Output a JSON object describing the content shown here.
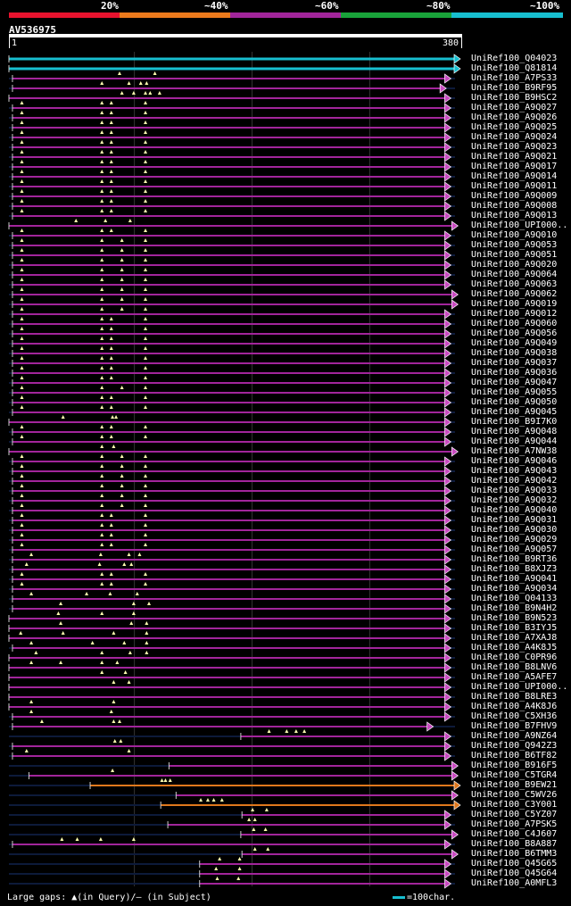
{
  "legend": [
    {
      "label": "20%",
      "color": "#e8132e"
    },
    {
      "label": "~40%",
      "color": "#ec7a1c"
    },
    {
      "label": "~60%",
      "color": "#a2259b"
    },
    {
      "label": "~80%",
      "color": "#19a33a"
    },
    {
      "label": "~100%",
      "color": "#17becf"
    }
  ],
  "query": {
    "name": "AV536975",
    "start": "1",
    "end": "380"
  },
  "footer": {
    "gaps": "Large gaps: ▲(in Query)/— (in Subject)",
    "scale": "=100char."
  },
  "hits": [
    {
      "name": "UniRef100_Q04023",
      "start": 1,
      "end": 380,
      "color": "cyan",
      "arrow": true,
      "marks": []
    },
    {
      "name": "UniRef100_Q81814",
      "start": 1,
      "end": 380,
      "color": "cyan",
      "arrow": true,
      "marks": []
    },
    {
      "name": "UniRef100_A7PS33",
      "start": 4,
      "end": 372,
      "color": "mag",
      "arrow": true,
      "marks": [
        95,
        125
      ]
    },
    {
      "name": "UniRef100_B9RF95",
      "start": 4,
      "end": 368,
      "color": "mag",
      "arrow": true,
      "marks": [
        80,
        103,
        113,
        118
      ]
    },
    {
      "name": "UniRef100_B9HSC2",
      "start": 1,
      "end": 372,
      "color": "mag",
      "arrow": true,
      "marks": [
        97,
        107,
        117,
        121,
        129
      ]
    },
    {
      "name": "UniRef100_A9Q027",
      "start": 4,
      "end": 372,
      "color": "mag",
      "arrow": true,
      "marks": [
        12,
        80,
        88,
        117
      ]
    },
    {
      "name": "UniRef100_A9Q026",
      "start": 4,
      "end": 372,
      "color": "mag",
      "arrow": true,
      "marks": [
        12,
        80,
        88,
        117
      ]
    },
    {
      "name": "UniRef100_A9Q025",
      "start": 4,
      "end": 372,
      "color": "mag",
      "arrow": true,
      "marks": [
        12,
        80,
        88,
        117
      ]
    },
    {
      "name": "UniRef100_A9Q024",
      "start": 4,
      "end": 372,
      "color": "mag",
      "arrow": true,
      "marks": [
        12,
        80,
        88,
        117
      ]
    },
    {
      "name": "UniRef100_A9Q023",
      "start": 4,
      "end": 372,
      "color": "mag",
      "arrow": true,
      "marks": [
        12,
        80,
        88,
        117
      ]
    },
    {
      "name": "UniRef100_A9Q021",
      "start": 4,
      "end": 372,
      "color": "mag",
      "arrow": true,
      "marks": [
        12,
        80,
        88,
        117
      ]
    },
    {
      "name": "UniRef100_A9Q017",
      "start": 4,
      "end": 372,
      "color": "mag",
      "arrow": true,
      "marks": [
        12,
        80,
        88,
        117
      ]
    },
    {
      "name": "UniRef100_A9Q014",
      "start": 4,
      "end": 372,
      "color": "mag",
      "arrow": true,
      "marks": [
        12,
        80,
        88,
        117
      ]
    },
    {
      "name": "UniRef100_A9Q011",
      "start": 4,
      "end": 372,
      "color": "mag",
      "arrow": true,
      "marks": [
        12,
        80,
        88,
        117
      ]
    },
    {
      "name": "UniRef100_A9Q009",
      "start": 4,
      "end": 372,
      "color": "mag",
      "arrow": true,
      "marks": [
        12,
        80,
        88,
        117
      ]
    },
    {
      "name": "UniRef100_A9Q008",
      "start": 4,
      "end": 372,
      "color": "mag",
      "arrow": true,
      "marks": [
        12,
        80,
        88,
        117
      ]
    },
    {
      "name": "UniRef100_A9Q013",
      "start": 4,
      "end": 372,
      "color": "mag",
      "arrow": true,
      "marks": [
        12,
        80,
        88,
        117
      ]
    },
    {
      "name": "UniRef100_UPI000..",
      "start": 1,
      "end": 378,
      "color": "mag",
      "arrow": true,
      "marks": [
        58,
        83,
        104
      ]
    },
    {
      "name": "UniRef100_A9Q010",
      "start": 4,
      "end": 372,
      "color": "mag",
      "arrow": true,
      "marks": [
        12,
        80,
        88,
        117
      ]
    },
    {
      "name": "UniRef100_A9Q053",
      "start": 4,
      "end": 372,
      "color": "mag",
      "arrow": true,
      "marks": [
        12,
        80,
        97,
        117
      ]
    },
    {
      "name": "UniRef100_A9Q051",
      "start": 4,
      "end": 372,
      "color": "mag",
      "arrow": true,
      "marks": [
        12,
        80,
        97,
        117
      ]
    },
    {
      "name": "UniRef100_A9Q020",
      "start": 4,
      "end": 372,
      "color": "mag",
      "arrow": true,
      "marks": [
        12,
        80,
        97,
        117
      ]
    },
    {
      "name": "UniRef100_A9Q064",
      "start": 4,
      "end": 372,
      "color": "mag",
      "arrow": true,
      "marks": [
        12,
        80,
        97,
        117
      ]
    },
    {
      "name": "UniRef100_A9Q063",
      "start": 4,
      "end": 372,
      "color": "mag",
      "arrow": true,
      "marks": [
        12,
        80,
        97,
        117
      ]
    },
    {
      "name": "UniRef100_A9Q062",
      "start": 4,
      "end": 378,
      "color": "mag",
      "arrow": true,
      "marks": [
        12,
        80,
        97,
        117
      ]
    },
    {
      "name": "UniRef100_A9Q019",
      "start": 4,
      "end": 378,
      "color": "mag",
      "arrow": true,
      "marks": [
        12,
        80,
        97,
        117
      ]
    },
    {
      "name": "UniRef100_A9Q012",
      "start": 4,
      "end": 372,
      "color": "mag",
      "arrow": true,
      "marks": [
        12,
        80,
        97,
        117
      ]
    },
    {
      "name": "UniRef100_A9Q060",
      "start": 4,
      "end": 372,
      "color": "mag",
      "arrow": true,
      "marks": [
        12,
        80,
        88,
        117
      ]
    },
    {
      "name": "UniRef100_A9Q056",
      "start": 4,
      "end": 372,
      "color": "mag",
      "arrow": true,
      "marks": [
        12,
        80,
        88,
        117
      ]
    },
    {
      "name": "UniRef100_A9Q049",
      "start": 4,
      "end": 372,
      "color": "mag",
      "arrow": true,
      "marks": [
        12,
        80,
        88,
        117
      ]
    },
    {
      "name": "UniRef100_A9Q038",
      "start": 4,
      "end": 372,
      "color": "mag",
      "arrow": true,
      "marks": [
        12,
        80,
        88,
        117
      ]
    },
    {
      "name": "UniRef100_A9Q037",
      "start": 4,
      "end": 372,
      "color": "mag",
      "arrow": true,
      "marks": [
        12,
        80,
        88,
        117
      ]
    },
    {
      "name": "UniRef100_A9Q036",
      "start": 4,
      "end": 372,
      "color": "mag",
      "arrow": true,
      "marks": [
        12,
        80,
        88,
        117
      ]
    },
    {
      "name": "UniRef100_A9Q047",
      "start": 4,
      "end": 372,
      "color": "mag",
      "arrow": true,
      "marks": [
        12,
        80,
        88,
        117
      ]
    },
    {
      "name": "UniRef100_A9Q055",
      "start": 4,
      "end": 372,
      "color": "mag",
      "arrow": true,
      "marks": [
        12,
        80,
        97,
        117
      ]
    },
    {
      "name": "UniRef100_A9Q050",
      "start": 4,
      "end": 372,
      "color": "mag",
      "arrow": true,
      "marks": [
        12,
        80,
        88,
        117
      ]
    },
    {
      "name": "UniRef100_A9Q045",
      "start": 4,
      "end": 372,
      "color": "mag",
      "arrow": true,
      "marks": [
        12,
        80,
        88,
        117
      ]
    },
    {
      "name": "UniRef100_B9I7K0",
      "start": 1,
      "end": 372,
      "color": "mag",
      "arrow": true,
      "marks": [
        47,
        89,
        92
      ]
    },
    {
      "name": "UniRef100_A9Q048",
      "start": 4,
      "end": 372,
      "color": "mag",
      "arrow": true,
      "marks": [
        12,
        80,
        88,
        117
      ]
    },
    {
      "name": "UniRef100_A9Q044",
      "start": 4,
      "end": 372,
      "color": "mag",
      "arrow": true,
      "marks": [
        12,
        80,
        88,
        117
      ]
    },
    {
      "name": "UniRef100_A7NW38",
      "start": 1,
      "end": 378,
      "color": "mag",
      "arrow": true,
      "marks": [
        80,
        90
      ]
    },
    {
      "name": "UniRef100_A9Q046",
      "start": 4,
      "end": 372,
      "color": "mag",
      "arrow": true,
      "marks": [
        12,
        80,
        97,
        117
      ]
    },
    {
      "name": "UniRef100_A9Q043",
      "start": 4,
      "end": 372,
      "color": "mag",
      "arrow": true,
      "marks": [
        12,
        80,
        97,
        117
      ]
    },
    {
      "name": "UniRef100_A9Q042",
      "start": 4,
      "end": 372,
      "color": "mag",
      "arrow": true,
      "marks": [
        12,
        80,
        97,
        117
      ]
    },
    {
      "name": "UniRef100_A9Q033",
      "start": 4,
      "end": 372,
      "color": "mag",
      "arrow": true,
      "marks": [
        12,
        80,
        97,
        117
      ]
    },
    {
      "name": "UniRef100_A9Q032",
      "start": 4,
      "end": 372,
      "color": "mag",
      "arrow": true,
      "marks": [
        12,
        80,
        97,
        117
      ]
    },
    {
      "name": "UniRef100_A9Q040",
      "start": 4,
      "end": 372,
      "color": "mag",
      "arrow": true,
      "marks": [
        12,
        80,
        97,
        117
      ]
    },
    {
      "name": "UniRef100_A9Q031",
      "start": 4,
      "end": 372,
      "color": "mag",
      "arrow": true,
      "marks": [
        12,
        80,
        88,
        117
      ]
    },
    {
      "name": "UniRef100_A9Q030",
      "start": 4,
      "end": 372,
      "color": "mag",
      "arrow": true,
      "marks": [
        12,
        80,
        88,
        117
      ]
    },
    {
      "name": "UniRef100_A9Q029",
      "start": 4,
      "end": 372,
      "color": "mag",
      "arrow": true,
      "marks": [
        12,
        80,
        88,
        117
      ]
    },
    {
      "name": "UniRef100_A9Q057",
      "start": 4,
      "end": 372,
      "color": "mag",
      "arrow": true,
      "marks": [
        12,
        80,
        88,
        117
      ]
    },
    {
      "name": "UniRef100_B9RT36",
      "start": 4,
      "end": 372,
      "color": "mag",
      "arrow": true,
      "marks": [
        20,
        79,
        103,
        112
      ]
    },
    {
      "name": "UniRef100_B8XJZ3",
      "start": 4,
      "end": 372,
      "color": "mag",
      "arrow": true,
      "marks": [
        16,
        78,
        99,
        105
      ]
    },
    {
      "name": "UniRef100_A9Q041",
      "start": 4,
      "end": 372,
      "color": "mag",
      "arrow": true,
      "marks": [
        12,
        80,
        88,
        117
      ]
    },
    {
      "name": "UniRef100_A9Q034",
      "start": 4,
      "end": 372,
      "color": "mag",
      "arrow": true,
      "marks": [
        12,
        80,
        88,
        117
      ]
    },
    {
      "name": "UniRef100_Q04133",
      "start": 4,
      "end": 372,
      "color": "mag",
      "arrow": true,
      "marks": [
        20,
        67,
        87,
        110
      ]
    },
    {
      "name": "UniRef100_B9N4H2",
      "start": 4,
      "end": 372,
      "color": "mag",
      "arrow": true,
      "marks": [
        45,
        107,
        120
      ]
    },
    {
      "name": "UniRef100_B9N523",
      "start": 1,
      "end": 372,
      "color": "mag",
      "arrow": true,
      "marks": [
        43,
        80,
        107
      ]
    },
    {
      "name": "UniRef100_B3IYJ5",
      "start": 1,
      "end": 372,
      "color": "mag",
      "arrow": true,
      "marks": [
        45,
        105,
        118
      ]
    },
    {
      "name": "UniRef100_A7XAJ8",
      "start": 1,
      "end": 372,
      "color": "mag",
      "arrow": true,
      "marks": [
        11,
        47,
        90,
        118
      ]
    },
    {
      "name": "UniRef100_A4K8J5",
      "start": 4,
      "end": 372,
      "color": "mag",
      "arrow": true,
      "marks": [
        20,
        72,
        99,
        118
      ]
    },
    {
      "name": "UniRef100_C0PR96",
      "start": 1,
      "end": 372,
      "color": "mag",
      "arrow": true,
      "marks": [
        24,
        80,
        104,
        118
      ]
    },
    {
      "name": "UniRef100_B8LNV6",
      "start": 1,
      "end": 372,
      "color": "mag",
      "arrow": true,
      "marks": [
        20,
        45,
        80,
        93
      ]
    },
    {
      "name": "UniRef100_A5AFE7",
      "start": 1,
      "end": 372,
      "color": "mag",
      "arrow": true,
      "marks": [
        80,
        100
      ]
    },
    {
      "name": "UniRef100_UPI000..",
      "start": 1,
      "end": 372,
      "color": "mag",
      "arrow": true,
      "marks": [
        90,
        103
      ]
    },
    {
      "name": "UniRef100_B8LRE3",
      "start": 1,
      "end": 372,
      "color": "mag",
      "arrow": true,
      "marks": []
    },
    {
      "name": "UniRef100_A4K8J6",
      "start": 1,
      "end": 372,
      "color": "mag",
      "arrow": true,
      "marks": [
        20,
        90
      ]
    },
    {
      "name": "UniRef100_C5XH36",
      "start": 4,
      "end": 372,
      "color": "mag",
      "arrow": true,
      "marks": [
        20,
        88
      ]
    },
    {
      "name": "UniRef100_B7FHV9",
      "start": 4,
      "end": 357,
      "color": "mag",
      "arrow": true,
      "marks": [
        29,
        90,
        95
      ]
    },
    {
      "name": "UniRef100_A9NZ64",
      "start": 198,
      "end": 372,
      "color": "mag",
      "arrow": true,
      "marks": [
        222,
        237,
        245,
        252
      ]
    },
    {
      "name": "UniRef100_Q942Z3",
      "start": 4,
      "end": 372,
      "color": "mag",
      "arrow": true,
      "marks": [
        91,
        96
      ]
    },
    {
      "name": "UniRef100_B6TF82",
      "start": 4,
      "end": 372,
      "color": "mag",
      "arrow": true,
      "marks": [
        16,
        103
      ]
    },
    {
      "name": "UniRef100_B916F5",
      "start": 137,
      "end": 378,
      "color": "mag",
      "arrow": true,
      "marks": []
    },
    {
      "name": "UniRef100_C5TGR4",
      "start": 18,
      "end": 378,
      "color": "mag",
      "arrow": true,
      "marks": [
        89
      ]
    },
    {
      "name": "UniRef100_B9EW21",
      "start": 70,
      "end": 380,
      "color": "orange",
      "arrow": true,
      "marks": [
        131,
        134,
        138
      ]
    },
    {
      "name": "UniRef100_C5WV26",
      "start": 143,
      "end": 378,
      "color": "mag",
      "arrow": true,
      "marks": []
    },
    {
      "name": "UniRef100_C3Y001",
      "start": 130,
      "end": 380,
      "color": "orange",
      "arrow": true,
      "marks": [
        164,
        170,
        175,
        182
      ]
    },
    {
      "name": "UniRef100_C5YZ07",
      "start": 199,
      "end": 372,
      "color": "mag",
      "arrow": true,
      "marks": [
        208,
        220
      ]
    },
    {
      "name": "UniRef100_A7PSK5",
      "start": 136,
      "end": 372,
      "color": "mag",
      "arrow": true,
      "marks": [
        205,
        210
      ]
    },
    {
      "name": "UniRef100_C4J607",
      "start": 198,
      "end": 378,
      "color": "mag",
      "arrow": true,
      "marks": [
        209,
        219
      ]
    },
    {
      "name": "UniRef100_B8A887",
      "start": 4,
      "end": 372,
      "color": "mag",
      "arrow": true,
      "marks": [
        46,
        59,
        79,
        107
      ]
    },
    {
      "name": "UniRef100_B6TMM3",
      "start": 199,
      "end": 378,
      "color": "mag",
      "arrow": true,
      "marks": [
        210,
        221
      ]
    },
    {
      "name": "UniRef100_Q45G65",
      "start": 163,
      "end": 372,
      "color": "mag",
      "arrow": true,
      "marks": [
        180,
        197
      ]
    },
    {
      "name": "UniRef100_Q45G64",
      "start": 163,
      "end": 372,
      "color": "mag",
      "arrow": true,
      "marks": [
        177,
        197
      ]
    },
    {
      "name": "UniRef100_A0MFL3",
      "start": 163,
      "end": 372,
      "color": "mag",
      "arrow": true,
      "marks": [
        178,
        196
      ]
    }
  ]
}
